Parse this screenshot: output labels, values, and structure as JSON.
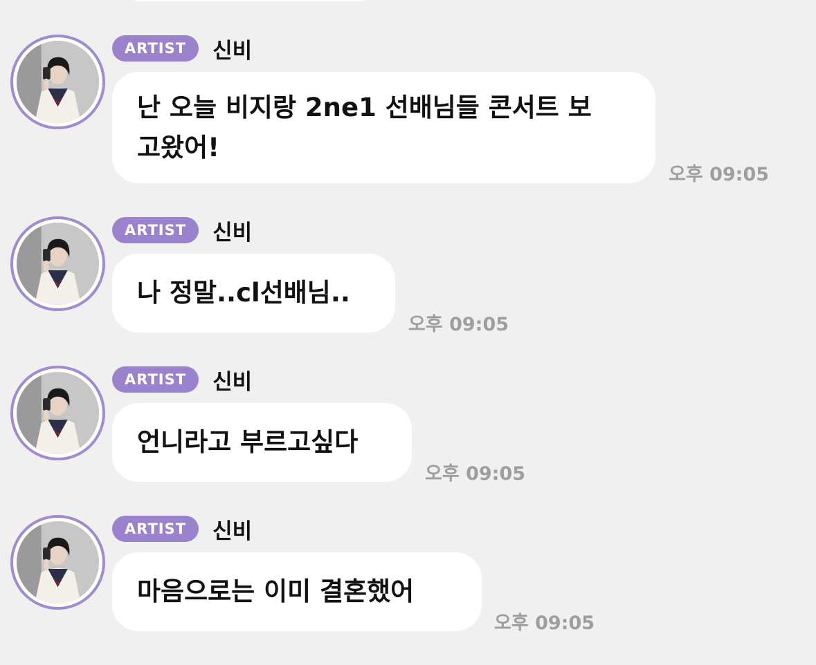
{
  "messages": [
    {
      "badge": "ARTIST",
      "sender": "신비",
      "text": "난 오늘 비지랑 2ne1 선배님들 콘서트 보\n고왔어!",
      "time": "오후 09:05"
    },
    {
      "badge": "ARTIST",
      "sender": "신비",
      "text": "나 정말..cl선배님..",
      "time": "오후 09:05"
    },
    {
      "badge": "ARTIST",
      "sender": "신비",
      "text": "언니라고 부르고싶다",
      "time": "오후 09:05"
    },
    {
      "badge": "ARTIST",
      "sender": "신비",
      "text": "마음으로는 이미 결혼했어",
      "time": "오후 09:05"
    }
  ],
  "colors": {
    "background": "#f0f0f1",
    "badge": "#9a82cd",
    "avatar_ring": "#a08ad0",
    "bubble": "#ffffff",
    "time": "#9e9e9e"
  }
}
